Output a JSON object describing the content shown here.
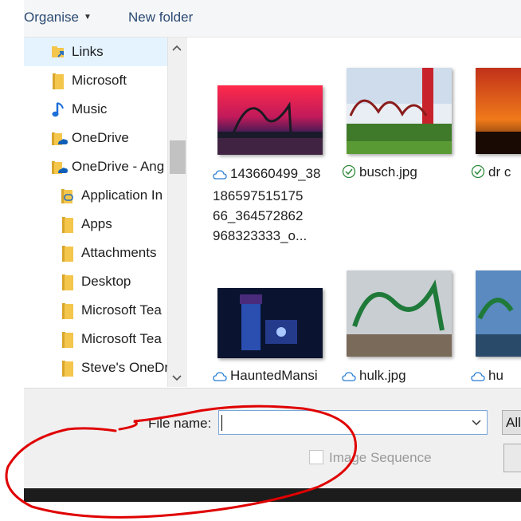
{
  "toolbar": {
    "organise_label": "Organise",
    "new_folder_label": "New folder"
  },
  "nav": {
    "items": [
      {
        "label": "Links",
        "icon": "links-folder-icon"
      },
      {
        "label": "Microsoft",
        "icon": "folder-icon"
      },
      {
        "label": "Music",
        "icon": "music-icon"
      },
      {
        "label": "OneDrive",
        "icon": "onedrive-folder-icon"
      },
      {
        "label": "OneDrive - Ang",
        "icon": "onedrive-folder-icon"
      },
      {
        "label": "Application In",
        "icon": "link-folder-icon"
      },
      {
        "label": "Apps",
        "icon": "folder-icon"
      },
      {
        "label": "Attachments",
        "icon": "folder-icon"
      },
      {
        "label": "Desktop",
        "icon": "folder-icon"
      },
      {
        "label": "Microsoft Tea",
        "icon": "folder-icon"
      },
      {
        "label": "Microsoft Tea",
        "icon": "folder-icon"
      },
      {
        "label": "Steve's OneDr",
        "icon": "folder-icon"
      }
    ]
  },
  "files": [
    {
      "caption_lines": [
        "143660499_38",
        "186597515175",
        "66_364572862",
        "968323333_o..."
      ],
      "status": "cloud"
    },
    {
      "caption_lines": [
        "busch.jpg"
      ],
      "status": "synced"
    },
    {
      "caption_lines": [
        "dr c"
      ],
      "status": "synced"
    },
    {
      "caption_lines": [
        "HauntedMansi"
      ],
      "status": "cloud"
    },
    {
      "caption_lines": [
        "hulk.jpg"
      ],
      "status": "cloud"
    },
    {
      "caption_lines": [
        "hu"
      ],
      "status": "cloud"
    }
  ],
  "bottom": {
    "file_name_label": "File name:",
    "file_name_value": "",
    "filter_label": "All",
    "image_sequence_label": "Image Sequence"
  },
  "colors": {
    "accent": "#0078d7",
    "annotation": "#e00000",
    "selected_bg": "#e5f3ff"
  }
}
